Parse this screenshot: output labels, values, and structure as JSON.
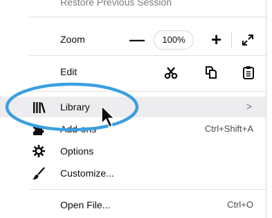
{
  "menu": {
    "restore_session": "Restore Previous Session",
    "zoom": {
      "label": "Zoom",
      "minus": "—",
      "value": "100%",
      "plus": "+"
    },
    "edit": {
      "label": "Edit"
    },
    "library": {
      "label": "Library",
      "chevron": ">"
    },
    "addons": {
      "label": "Add-ons",
      "shortcut": "Ctrl+Shift+A"
    },
    "options": {
      "label": "Options"
    },
    "customize": {
      "label": "Customize..."
    },
    "open_file": {
      "label": "Open File...",
      "shortcut": "Ctrl+O"
    }
  },
  "colors": {
    "highlight_ring": "#3b9fe0",
    "hover_row": "#ededf0",
    "separator": "#e0e0e2",
    "addon_icon": "#0c0c0d"
  },
  "icons": {
    "zoom_fullscreen": "expand-icon",
    "cut": "scissors-icon",
    "copy": "copy-icon",
    "paste": "clipboard-icon",
    "library": "library-icon",
    "addons": "puzzle-icon",
    "options": "gear-icon",
    "customize": "brush-icon"
  }
}
